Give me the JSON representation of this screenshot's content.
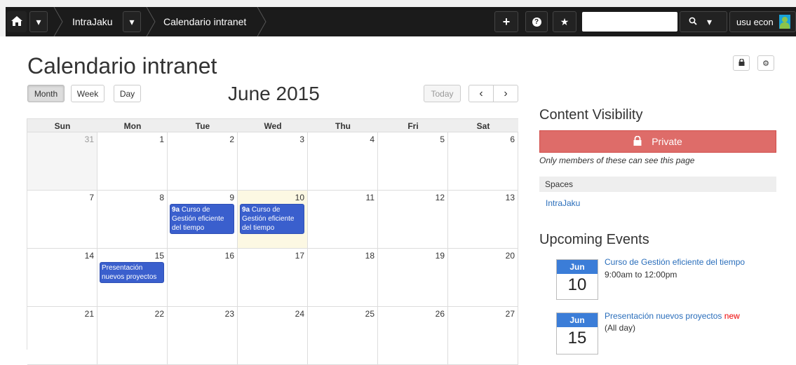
{
  "topbar": {
    "home_icon": "home-icon",
    "breadcrumbs": [
      "IntraJaku",
      "Calendario intranet"
    ],
    "user_label": "usu econ",
    "search_value": ""
  },
  "page": {
    "title": "Calendario intranet"
  },
  "calendar": {
    "views": [
      "Month",
      "Week",
      "Day"
    ],
    "active_view": "Month",
    "month_title": "June 2015",
    "today_label": "Today",
    "prev_label": "‹",
    "next_label": "›",
    "weekdays": [
      "Sun",
      "Mon",
      "Tue",
      "Wed",
      "Thu",
      "Fri",
      "Sat"
    ],
    "weeks": [
      [
        "31",
        "1",
        "2",
        "3",
        "4",
        "5",
        "6"
      ],
      [
        "7",
        "8",
        "9",
        "10",
        "11",
        "12",
        "13"
      ],
      [
        "14",
        "15",
        "16",
        "17",
        "18",
        "19",
        "20"
      ],
      [
        "21",
        "22",
        "23",
        "24",
        "25",
        "26",
        "27"
      ]
    ],
    "events": {
      "tue_9": {
        "time": "9a",
        "title": "Curso de Gestión eficiente del tiempo"
      },
      "wed_10": {
        "time": "9a",
        "title": "Curso de Gestión eficiente del tiempo"
      },
      "mon_15": {
        "time": "",
        "title": "Presentación nuevos proyectos"
      }
    }
  },
  "visibility": {
    "heading": "Content Visibility",
    "status": "Private",
    "note": "Only members of these can see this page",
    "spaces_heading": "Spaces",
    "spaces": [
      "IntraJaku"
    ]
  },
  "upcoming": {
    "heading": "Upcoming Events",
    "items": [
      {
        "month": "Jun",
        "day": "10",
        "title": "Curso de Gestión eficiente del tiempo",
        "when": "9:00am to 12:00pm",
        "badge": ""
      },
      {
        "month": "Jun",
        "day": "15",
        "title": "Presentación nuevos proyectos",
        "when": "(All day)",
        "badge": "new"
      }
    ]
  }
}
